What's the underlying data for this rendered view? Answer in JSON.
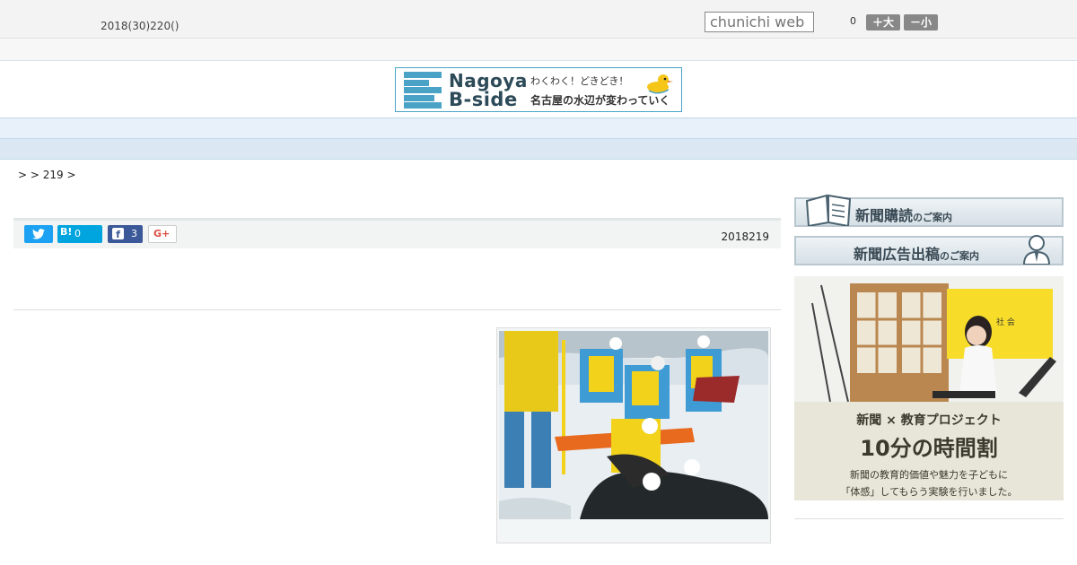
{
  "header": {
    "date": "2018(30)220()",
    "search_placeholder": "chunichi web",
    "font_size_count": "0",
    "font_larger_label": "＋大",
    "font_smaller_label": "－小"
  },
  "banner": {
    "title_line1": "Nagoya",
    "title_line2": "B-side",
    "tagline1": "わくわく！どきどき！",
    "tagline2": "名古屋の水辺が変わっていく",
    "accent": "#4aa3c7"
  },
  "nav": {
    "items": [
      "",
      "",
      "",
      "",
      "",
      "",
      "",
      "",
      ""
    ]
  },
  "breadcrumb": ">  > 219 >",
  "article": {
    "date": "2018219",
    "share": {
      "twitter_icon": "twitter-icon",
      "hatena_label": "B!",
      "hatena_count": "0",
      "facebook_count": "3",
      "gplus_label": "G+"
    }
  },
  "sidebar": {
    "subscribe_main": "新聞購読",
    "subscribe_sub": "のご案内",
    "ad_main": "新聞広告出稿",
    "ad_sub": "のご案内",
    "promo_line1": "新聞 × 教育プロジェクト",
    "promo_line2": "10分の時間割",
    "promo_line3": "新聞の教育的価値や魅力を子どもに",
    "promo_line4": "「体感」してもらう実験を行いました。",
    "promo_board": "社 会"
  },
  "colors": {
    "nav_bg": "#e8f1f9",
    "twitter": "#1da1f2",
    "hatena": "#00a4de",
    "facebook": "#3b5998"
  }
}
